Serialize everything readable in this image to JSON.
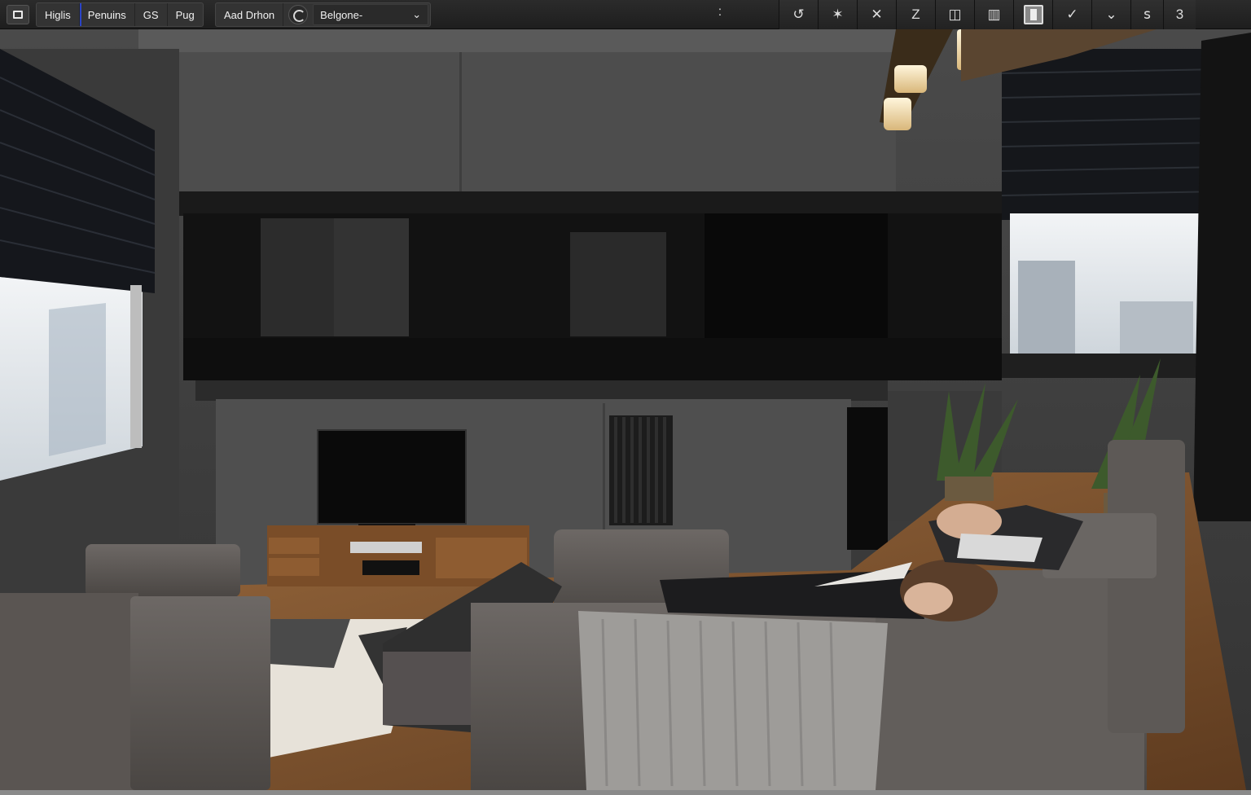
{
  "toolbar": {
    "app_icon": "window-icon",
    "group1": {
      "items": [
        "Higlis",
        "Penuins",
        "GS",
        "Pug"
      ]
    },
    "group2": {
      "button_label": "Aad Drhon",
      "refresh_icon": "refresh-icon",
      "select_value": "Belgone-",
      "select_chevron": "chevron-down-icon"
    },
    "overflow_label": ":",
    "right_icons": [
      {
        "name": "reset-icon",
        "glyph": "↺"
      },
      {
        "name": "star-icon",
        "glyph": "✶"
      },
      {
        "name": "tools-icon",
        "glyph": "✕"
      },
      {
        "name": "text-icon",
        "glyph": "Z"
      },
      {
        "name": "document-icon",
        "glyph": "◫"
      },
      {
        "name": "print-icon",
        "glyph": "▥"
      },
      {
        "name": "clipboard-icon",
        "glyph": ""
      },
      {
        "name": "check-icon",
        "glyph": "✓"
      },
      {
        "name": "chevron-down-icon",
        "glyph": "⌄"
      },
      {
        "name": "info-icon",
        "glyph": "ꜱ"
      },
      {
        "name": "more-icon",
        "glyph": "3"
      }
    ]
  },
  "canvas": {
    "image_name": "living-room-render",
    "colors": {
      "wall": "#3b3b3b",
      "floor": "#8a5a32",
      "sofa": "#5f5b58",
      "window_light": "#e9ecef"
    }
  }
}
